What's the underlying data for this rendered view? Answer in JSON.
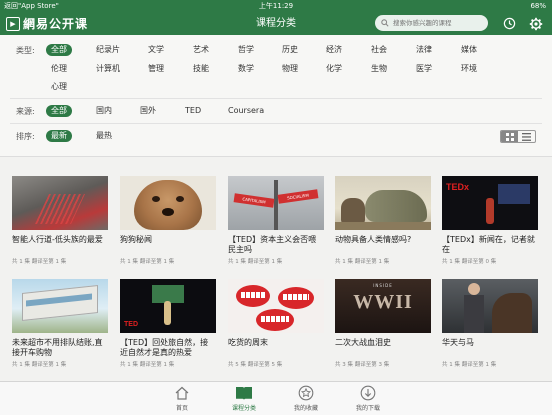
{
  "status": {
    "left": "返回\"App Store\"",
    "time": "上午11:29",
    "battery": "68%"
  },
  "nav": {
    "logo_text": "網易公开课",
    "title": "课程分类",
    "search_placeholder": "搜索你感兴趣的课程"
  },
  "filters": {
    "type_label": "类型:",
    "type_row1": [
      "全部",
      "纪录片",
      "文学",
      "艺术",
      "哲学",
      "历史",
      "经济",
      "社会",
      "法律",
      "媒体"
    ],
    "type_row2": [
      "伦理",
      "计算机",
      "管理",
      "技能",
      "数学",
      "物理",
      "化学",
      "生物",
      "医学",
      "环境"
    ],
    "type_row3": [
      "心理"
    ],
    "source_label": "来源:",
    "sources": [
      "全部",
      "国内",
      "国外",
      "TED",
      "Coursera"
    ],
    "sort_label": "排序:",
    "sorts": [
      "最新",
      "最热"
    ],
    "accent": "#2e7a46"
  },
  "courses": [
    {
      "title": "智能人行道-低头族的最爱",
      "meta": "共 1 集  翻译至第 1 集"
    },
    {
      "title": "狗狗秘闻",
      "meta": "共 1 集  翻译至第 1 集"
    },
    {
      "title": "【TED】资本主义会否喂民主吗",
      "meta": "共 1 集  翻译至第 1 集",
      "thumb_signs": [
        "CAPITALISM",
        "SOCIALISM"
      ]
    },
    {
      "title": "动物具备人类情感吗?",
      "meta": "共 1 集  翻译至第 1 集"
    },
    {
      "title": "【TEDx】新闻在，记者就在",
      "meta": "共 1 集  翻译至第 0 集",
      "thumb_text": "TEDx"
    },
    {
      "title": "未来超市不用排队结账,直接开车购物",
      "meta": "共 1 集  翻译至第 1 集"
    },
    {
      "title": "【TED】回处旅自然，接近自然才是真的热爱",
      "meta": "共 1 集  翻译至第 1 集",
      "thumb_text": "TED"
    },
    {
      "title": "吃货的周末",
      "meta": "共 5 集  翻译至第 5 集"
    },
    {
      "title": "二次大战血泪史",
      "meta": "共 3 集  翻译至第 3 集",
      "thumb_text": "WWII",
      "thumb_sub": "INSIDE"
    },
    {
      "title": "华天与马",
      "meta": "共 1 集  翻译至第 1 集"
    }
  ],
  "tabs": [
    {
      "label": "首页",
      "icon": "home-icon"
    },
    {
      "label": "课程分类",
      "icon": "book-icon",
      "active": true
    },
    {
      "label": "我的收藏",
      "icon": "star-icon"
    },
    {
      "label": "我的下载",
      "icon": "download-icon"
    }
  ]
}
